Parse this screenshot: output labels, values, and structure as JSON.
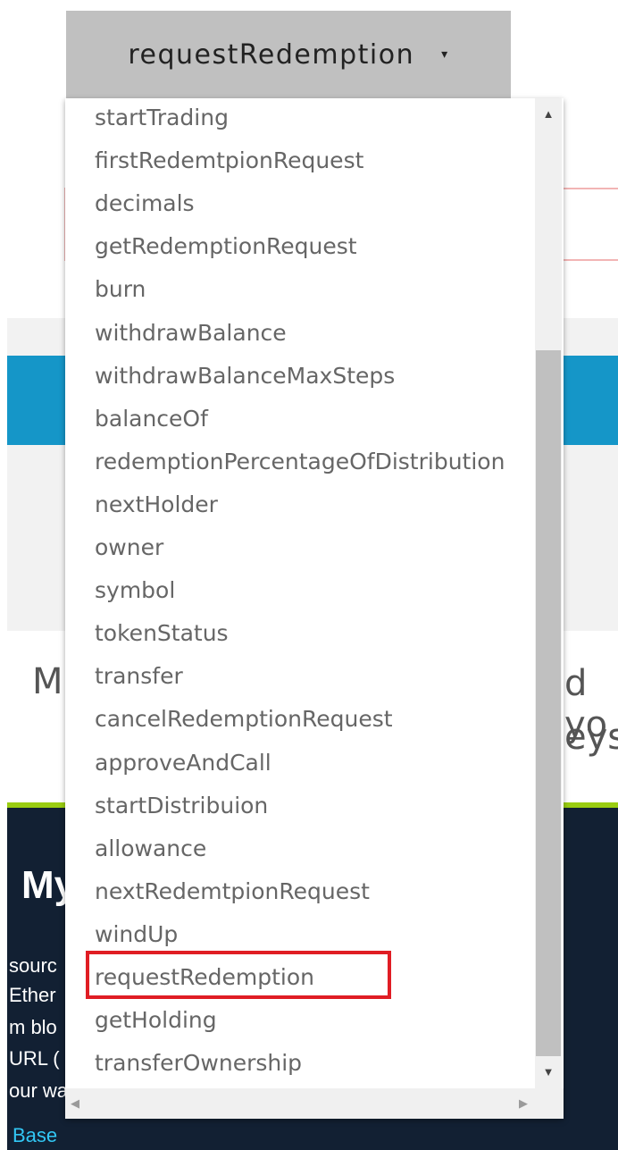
{
  "select": {
    "selected_label": "requestRedemption",
    "caret": "▾"
  },
  "dropdown": {
    "options": [
      "startTrading",
      "firstRedemtpionRequest",
      "decimals",
      "getRedemptionRequest",
      "burn",
      "withdrawBalance",
      "withdrawBalanceMaxSteps",
      "balanceOf",
      "redemptionPercentageOfDistribution",
      "nextHolder",
      "owner",
      "symbol",
      "tokenStatus",
      "transfer",
      "cancelRedemptionRequest",
      "approveAndCall",
      "startDistribuion",
      "allowance",
      "nextRedemtpionRequest",
      "windUp",
      "requestRedemption",
      "getHolding",
      "transferOwnership"
    ],
    "highlighted": "requestRedemption",
    "scroll_up": "▲",
    "scroll_down": "▼",
    "scroll_left": "◀",
    "scroll_right": "▶"
  },
  "background": {
    "partial_text_left": "M",
    "partial_text_right_1": "d yo",
    "partial_text_right_2": "eys",
    "dark_heading": "My",
    "dark_lines": [
      "sourc",
      "Ether",
      "m blo",
      "URL ( r",
      "our wa"
    ],
    "base_link": "Base"
  },
  "colors": {
    "highlight_border": "#e01d24",
    "blue_band": "#1596c8",
    "dark_footer": "#122033",
    "accent_green": "#9acd12",
    "link": "#32c7f5"
  }
}
